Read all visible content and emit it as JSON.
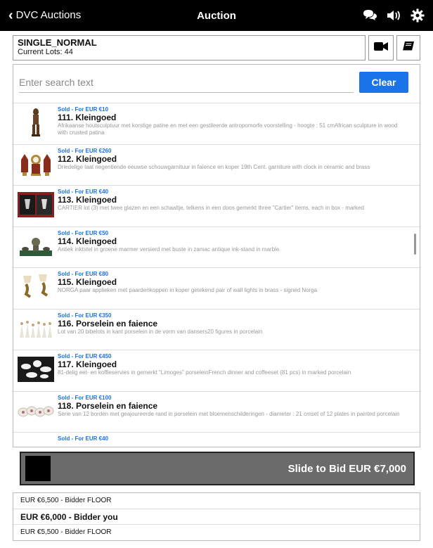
{
  "header": {
    "back_label": "DVC Auctions",
    "title": "Auction",
    "icons": [
      "chat-icon",
      "speaker-icon",
      "gear-icon"
    ]
  },
  "session": {
    "name": "SINGLE_NORMAL",
    "lots_label": "Current Lots: 44"
  },
  "search": {
    "placeholder": "Enter search text",
    "value": "",
    "clear_label": "Clear"
  },
  "lots": [
    {
      "sold": "Sold - For EUR €10",
      "title": "111. Kleingoed",
      "desc": "Afrikaanse houtsculptuur met korstige patine en met een gestileerde antropomorfe voorstelling  -  hoogte : 51 cmAfrican sculpture in wood with crusted patina"
    },
    {
      "sold": "Sold - For EUR €260",
      "title": "112. Kleingoed",
      "desc": "Driedelige laat negentiende eeuwse schouwgarnituur in faïence en koper 19th Cent. garniture with clock in ceramic and brass"
    },
    {
      "sold": "Sold - For EUR €40",
      "title": "113. Kleingoed",
      "desc": "CARTIER lot (3) met twee glazen en een schaaltje, telkens in een doos gemerkt three \"Cartier\" items, each in box - marked"
    },
    {
      "sold": "Sold - For EUR €50",
      "title": "114. Kleingoed",
      "desc": "Antiek inktstel in groene marmer versierd met buste in zamac  antique ink-stand in marble"
    },
    {
      "sold": "Sold - For EUR €80",
      "title": "115. Kleingoed",
      "desc": "NORGA paar applieken met paardenkoppen in koper getekend pair of wall lights in brass - signed Norga"
    },
    {
      "sold": "Sold - For EUR €350",
      "title": "116. Porselein en faience",
      "desc": "Lot van 20 bibelots in kant porselein in de vorm van dansers20 figures in porcelain"
    },
    {
      "sold": "Sold - For EUR €450",
      "title": "117. Kleingoed",
      "desc": "81-delig eet- en koffieservies in gemerkt \"Limoges\" porseleinFrench dinner and coffeeset (81 pcs) in marked porcelain"
    },
    {
      "sold": "Sold - For EUR €100",
      "title": "118. Porselein en faience",
      "desc": "Serie van 12 borden met geajoureerde rand in porselein met bloemenschilderingen  -  diameter : 21 cmset of 12 plates in painted porcelain"
    },
    {
      "sold": "Sold - For EUR €40",
      "title": "",
      "desc": ""
    }
  ],
  "slider": {
    "label": "Slide to Bid EUR €7,000"
  },
  "bids": [
    {
      "text": "EUR €6,500 - Bidder FLOOR",
      "you": false
    },
    {
      "text": "EUR €6,000 - Bidder you",
      "you": true
    },
    {
      "text": "EUR €5,500 - Bidder FLOOR",
      "you": false
    }
  ],
  "colors": {
    "accent": "#1a73e8",
    "topbar": "#000000",
    "slider_bg": "#6b6b6b"
  }
}
